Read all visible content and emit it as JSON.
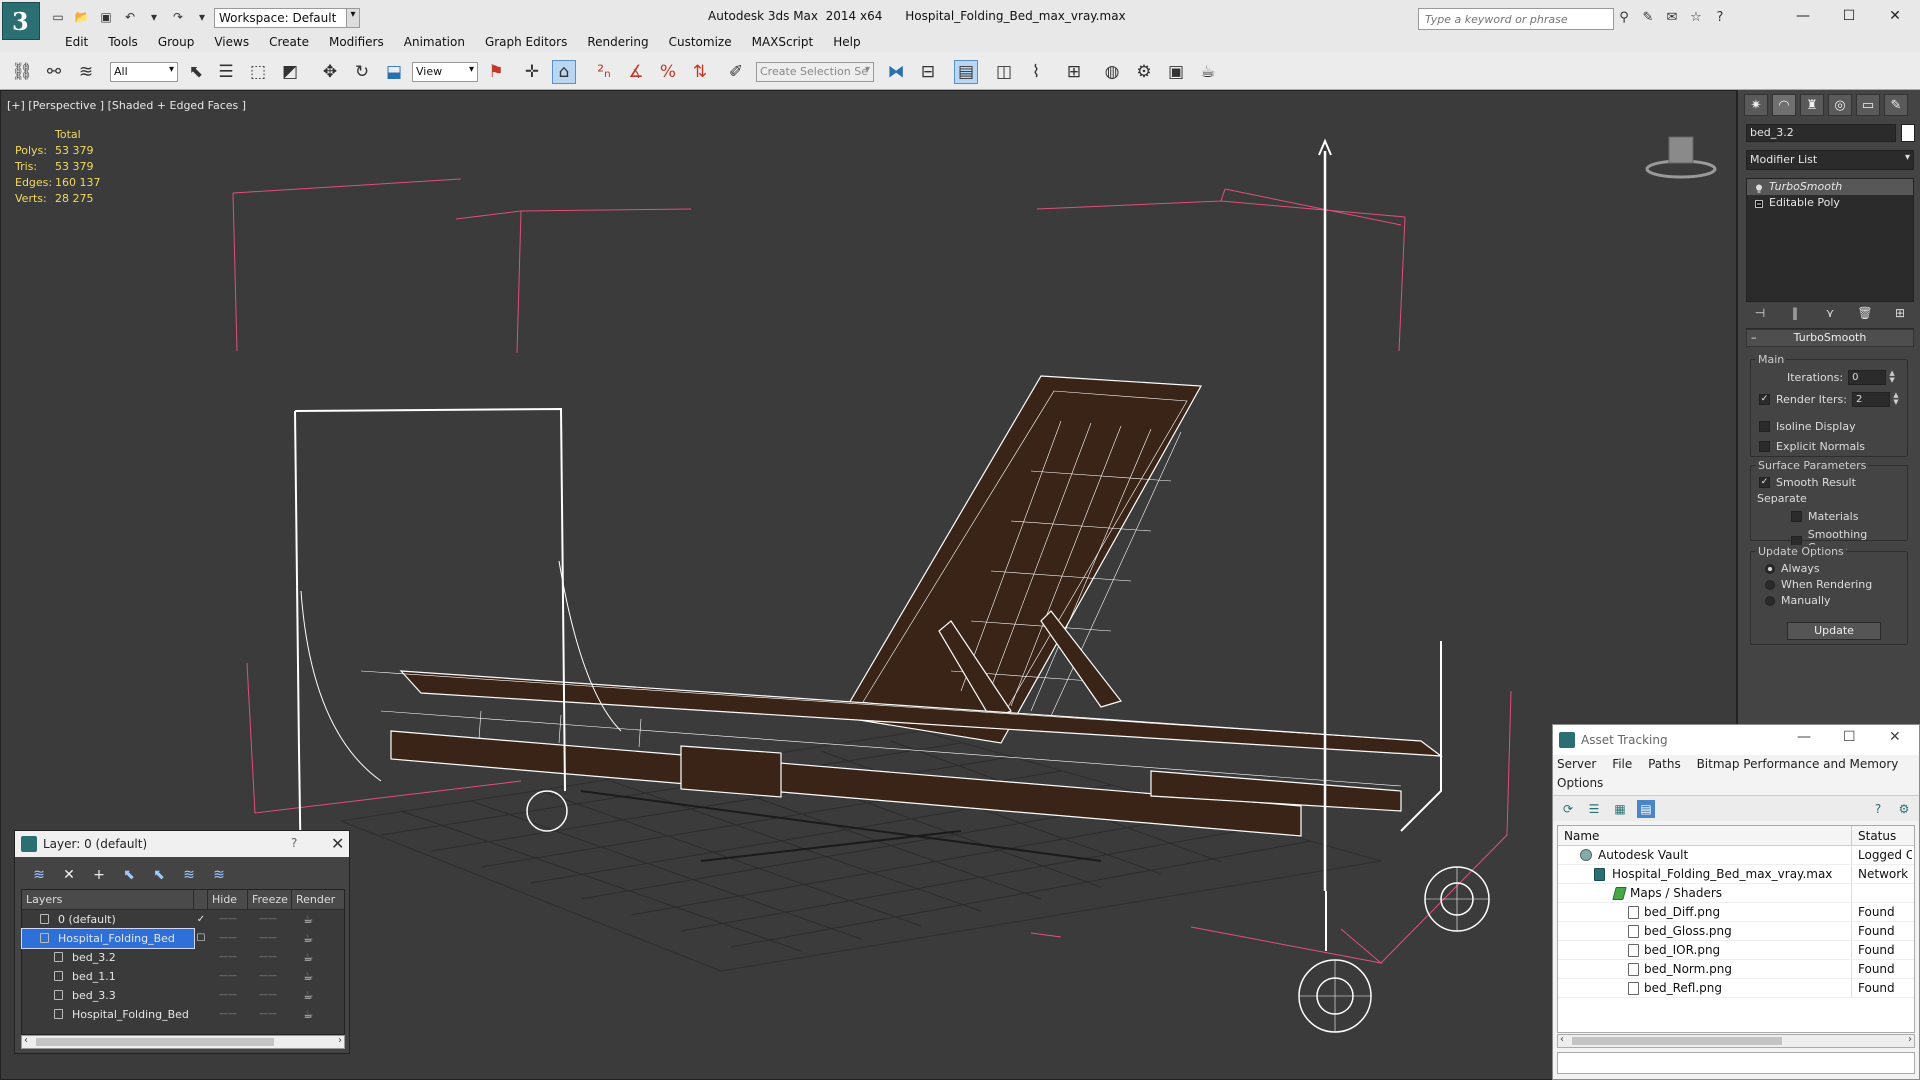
{
  "app": {
    "logo_glyph": "3",
    "window_title": "Autodesk 3ds Max  2014 x64      Hospital_Folding_Bed_max_vray.max",
    "workspace_label": "Workspace: Default",
    "search_placeholder": "Type a keyword or phrase"
  },
  "menu": [
    "Edit",
    "Tools",
    "Group",
    "Views",
    "Create",
    "Modifiers",
    "Animation",
    "Graph Editors",
    "Rendering",
    "Customize",
    "MAXScript",
    "Help"
  ],
  "toolbar": {
    "filter_value": "All",
    "refcoord_value": "View",
    "selection_set_placeholder": "Create Selection Se"
  },
  "viewport": {
    "label": "[+] [Perspective ] [Shaded + Edged Faces ]",
    "stats_total_label": "Total",
    "stats": [
      {
        "key": "Polys:",
        "value": "53 379"
      },
      {
        "key": "Tris:",
        "value": "53 379"
      },
      {
        "key": "Edges:",
        "value": "160 137"
      },
      {
        "key": "Verts:",
        "value": "28 275"
      }
    ],
    "stats_color": "#f2d95c",
    "bbox_color": "#e0507a",
    "wire_color": "#ffffff",
    "mesh_color": "#3a2418"
  },
  "command_panel": {
    "object_name": "bed_3.2",
    "modifier_list_label": "Modifier List",
    "stack": [
      {
        "label": "TurboSmooth",
        "selected": true
      },
      {
        "label": "Editable Poly",
        "selected": false
      }
    ],
    "rollout_title": "TurboSmooth",
    "main_group": "Main",
    "iterations_label": "Iterations:",
    "iterations_value": "0",
    "render_iters_label": "Render Iters:",
    "render_iters_value": "2",
    "isoline_label": "Isoline Display",
    "explicit_normals_label": "Explicit Normals",
    "surface_group": "Surface Parameters",
    "smooth_result_label": "Smooth Result",
    "separate_label": "Separate",
    "materials_label": "Materials",
    "smoothing_groups_label": "Smoothing Groups",
    "update_group": "Update Options",
    "always_label": "Always",
    "when_rendering_label": "When Rendering",
    "manually_label": "Manually",
    "update_button": "Update"
  },
  "layer_window": {
    "title": "Layer: 0 (default)",
    "help": "?",
    "columns": {
      "layers": "Layers",
      "hide": "Hide",
      "freeze": "Freeze",
      "render": "Render"
    },
    "rows": [
      {
        "name": "0 (default)",
        "flag": "✓",
        "selected": false,
        "child": false
      },
      {
        "name": "Hospital_Folding_Bed",
        "flag": "☐",
        "selected": true,
        "child": false
      },
      {
        "name": "bed_3.2",
        "flag": "",
        "selected": false,
        "child": true
      },
      {
        "name": "bed_1.1",
        "flag": "",
        "selected": false,
        "child": true
      },
      {
        "name": "bed_3.3",
        "flag": "",
        "selected": false,
        "child": true
      },
      {
        "name": "Hospital_Folding_Bed",
        "flag": "",
        "selected": false,
        "child": true
      }
    ]
  },
  "asset_window": {
    "title": "Asset Tracking",
    "menu": [
      "Server",
      "File",
      "Paths",
      "Bitmap Performance and Memory"
    ],
    "menu_options": "Options",
    "columns": {
      "name": "Name",
      "status": "Status"
    },
    "rows": [
      {
        "name": "Autodesk Vault",
        "status": "Logged Out",
        "indent": 1,
        "glyph": "vault"
      },
      {
        "name": "Hospital_Folding_Bed_max_vray.max",
        "status": "Network P",
        "indent": 2,
        "glyph": "max"
      },
      {
        "name": "Maps / Shaders",
        "status": "",
        "indent": 3,
        "glyph": "folder"
      },
      {
        "name": "bed_Diff.png",
        "status": "Found",
        "indent": 4,
        "glyph": "file"
      },
      {
        "name": "bed_Gloss.png",
        "status": "Found",
        "indent": 4,
        "glyph": "file"
      },
      {
        "name": "bed_IOR.png",
        "status": "Found",
        "indent": 4,
        "glyph": "file"
      },
      {
        "name": "bed_Norm.png",
        "status": "Found",
        "indent": 4,
        "glyph": "file"
      },
      {
        "name": "bed_Refl.png",
        "status": "Found",
        "indent": 4,
        "glyph": "file"
      }
    ]
  }
}
